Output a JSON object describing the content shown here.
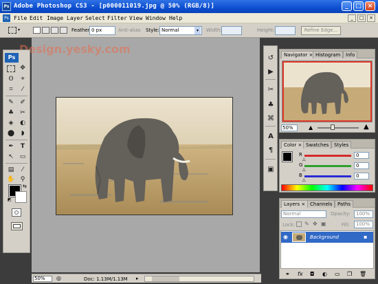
{
  "window": {
    "title": "Adobe Photoshop CS3 - [p000011019.jpg @ 50% (RGB/8)]",
    "app_icon_label": "Ps",
    "controls": [
      "_",
      "□",
      "×"
    ]
  },
  "menubar": {
    "items": [
      "File",
      "Edit",
      "Image",
      "Layer",
      "Select",
      "Filter",
      "View",
      "Window",
      "Help"
    ],
    "mdi_controls": [
      "_",
      "□",
      "×"
    ]
  },
  "options": {
    "feather_label": "Feather:",
    "feather_value": "0 px",
    "antialias_label": "Anti-alias",
    "style_label": "Style:",
    "style_value": "Normal",
    "width_label": "Width:",
    "height_label": "Height:",
    "refine_edge_label": "Refine Edge..."
  },
  "watermark": "Design.yesky.com",
  "toolbox": {
    "logo": "Ps",
    "tools": [
      "▭",
      "✥",
      "ʘ",
      "⌖",
      "⌗",
      "⁄",
      "✎",
      "✐",
      "♣",
      "✂",
      "◈",
      "◐",
      "⬤",
      "◗",
      "✒",
      "T",
      "↖",
      "▭",
      "✋",
      "🔍"
    ]
  },
  "status": {
    "zoom": "50%",
    "doc_info": "Doc: 1.13M/1.13M"
  },
  "navigator": {
    "tabs": [
      "Navigator",
      "Histogram",
      "Info"
    ],
    "zoom": "50%",
    "zoom_level": 0.35
  },
  "color_panel": {
    "tabs": [
      "Color",
      "Swatches",
      "Styles"
    ],
    "channels": [
      {
        "label": "R",
        "value": "0",
        "color": "#d42a2a"
      },
      {
        "label": "G",
        "value": "0",
        "color": "#2ea02e"
      },
      {
        "label": "B",
        "value": "0",
        "color": "#2a2ad4"
      }
    ]
  },
  "layers_panel": {
    "tabs": [
      "Layers",
      "Channels",
      "Paths"
    ],
    "blend_mode": "Normal",
    "opacity_label": "Opacity:",
    "opacity_value": "100%",
    "lock_label": "Lock:",
    "fill_label": "Fill:",
    "fill_value": "100%",
    "layer_name": "Background"
  },
  "colors": {
    "title_blue": "#0d4fd0",
    "selected_layer": "#3169c6",
    "navigator_frame": "#e0382a"
  }
}
